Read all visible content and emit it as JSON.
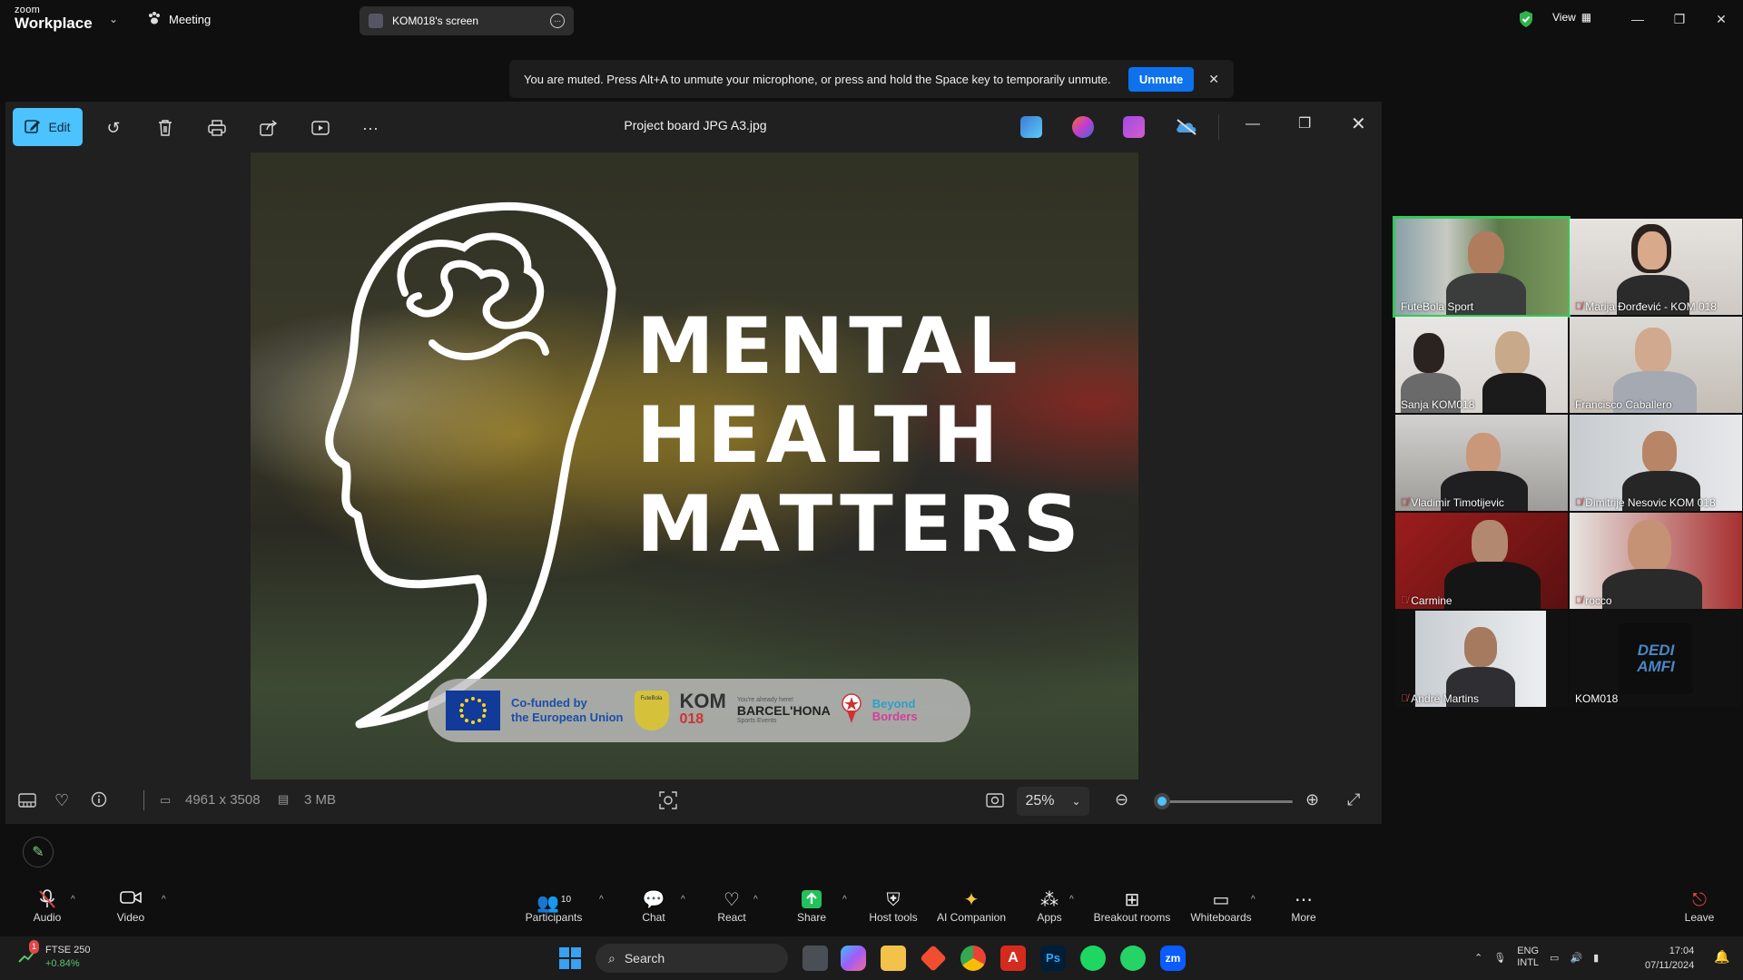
{
  "zoom": {
    "logo_top": "zoom",
    "logo_bottom": "Workplace",
    "meeting_label": "Meeting",
    "screen_label": "KOM018's screen",
    "view_label": "View"
  },
  "banner": {
    "message": "You are muted. Press Alt+A to unmute your microphone, or press and hold the Space key to temporarily unmute.",
    "unmute_label": "Unmute"
  },
  "photos": {
    "edit_label": "Edit",
    "file_title": "Project board JPG A3.jpg",
    "dimensions": "4961 x 3508",
    "file_size": "3 MB",
    "zoom_level": "25%",
    "zoom_fraction": 0.05
  },
  "poster": {
    "line1": "MENTAL",
    "line2": "HEALTH",
    "line3": "MATTERS",
    "eu_line1": "Co-funded by",
    "eu_line2": "the European Union",
    "futebola": "FuteBola",
    "kom_a": "KOM",
    "kom_b": "018",
    "barcelona_tag": "You're already here!",
    "barcelona": "BARCEL'HONA",
    "barcelona_sub": "Sports Events",
    "beyond_a": "Beyond",
    "beyond_b": "Borders"
  },
  "participants": [
    {
      "name": "FuteBola Sport",
      "muted": false
    },
    {
      "name": "Marija Đorđević - KOM 018",
      "muted": true
    },
    {
      "name": "Sanja KOM018",
      "muted": false
    },
    {
      "name": "Francisco Caballero",
      "muted": false
    },
    {
      "name": "Vladimir Timotijevic",
      "muted": true
    },
    {
      "name": "Dimitrije Nesovic KOM 018",
      "muted": true
    },
    {
      "name": "Carmine",
      "muted": true
    },
    {
      "name": "rocco",
      "muted": true
    },
    {
      "name": "André Martins",
      "muted": true
    },
    {
      "name": "KOM018",
      "muted": false
    }
  ],
  "kom_avatar_text": "DEDI AMFI",
  "controls": {
    "audio": "Audio",
    "video": "Video",
    "participants": "Participants",
    "participants_count": "10",
    "chat": "Chat",
    "react": "React",
    "share": "Share",
    "host_tools": "Host tools",
    "ai_companion": "AI Companion",
    "apps": "Apps",
    "breakout": "Breakout rooms",
    "whiteboards": "Whiteboards",
    "more": "More",
    "leave": "Leave"
  },
  "taskbar": {
    "ticker": "FTSE 250",
    "ticker_change": "+0.84%",
    "badge": "1",
    "search": "Search",
    "lang1": "ENG",
    "lang2": "INTL",
    "time": "17:04",
    "date": "07/11/2024"
  },
  "colors": {
    "zoom_blue": "#0e72ed",
    "photos_accent": "#4cc2ff",
    "active_speaker": "#35c759",
    "muted_red": "#e04848"
  }
}
